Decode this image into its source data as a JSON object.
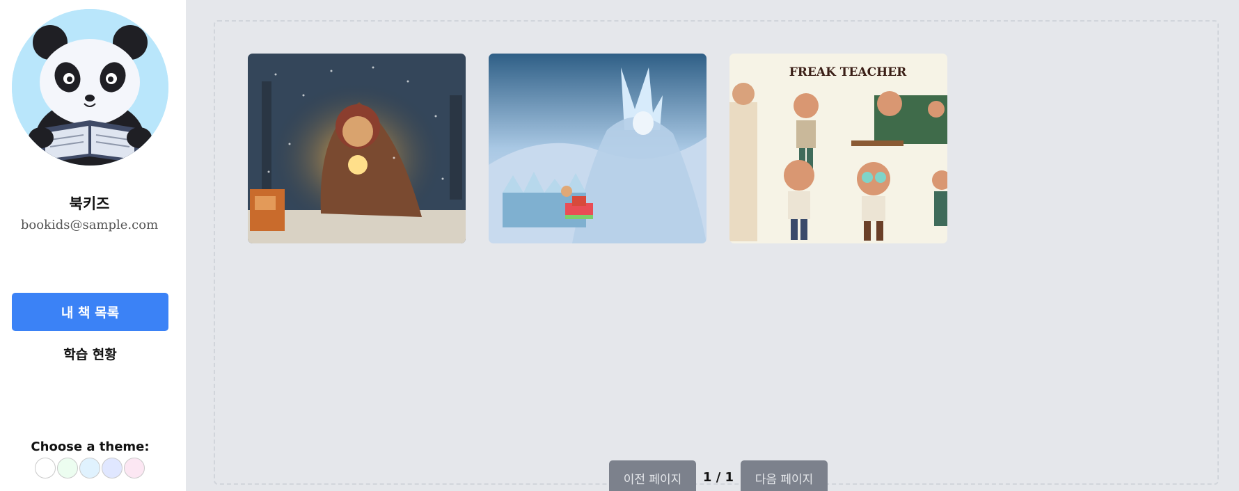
{
  "sidebar": {
    "user_name": "북키즈",
    "user_email": "bookids@sample.com",
    "nav": {
      "my_books": "내 책 목록",
      "learning_status": "학습 현황"
    },
    "theme": {
      "label": "Choose a theme:",
      "swatches": [
        "#ffffff",
        "#ecfdf0",
        "#e0f2fe",
        "#e0e7ff",
        "#fce7f3"
      ]
    }
  },
  "books": [
    {
      "cover": "girl-with-candle-in-snow"
    },
    {
      "cover": "ice-queen-with-child"
    },
    {
      "cover": "freak-teacher",
      "cover_title": "FREAK TEACHER"
    }
  ],
  "pagination": {
    "prev_label": "이전 페이지",
    "next_label": "다음 페이지",
    "indicator": "1 / 1"
  }
}
